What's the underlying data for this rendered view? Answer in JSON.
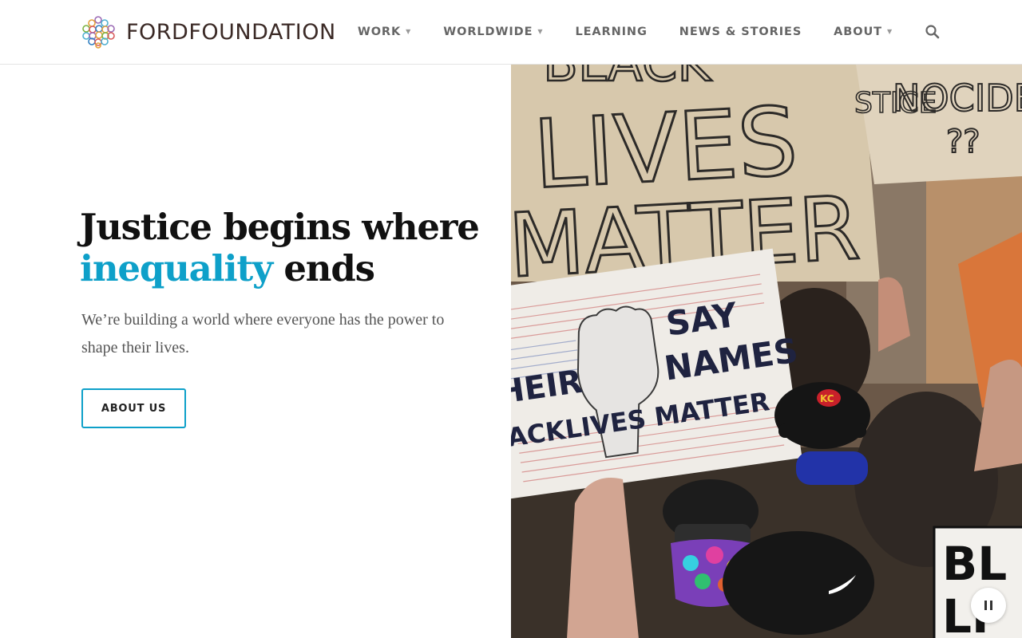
{
  "brand": {
    "name_strong": "FORD",
    "name_light": "FOUNDATION",
    "icon": "ford-foundation-logo-mark"
  },
  "nav": {
    "items": [
      {
        "label": "WORK",
        "has_dropdown": true
      },
      {
        "label": "WORLDWIDE",
        "has_dropdown": true
      },
      {
        "label": "LEARNING",
        "has_dropdown": false
      },
      {
        "label": "NEWS & STORIES",
        "has_dropdown": false
      },
      {
        "label": "ABOUT",
        "has_dropdown": true
      }
    ],
    "search_icon": "search-icon"
  },
  "hero": {
    "headline_part1": "Justice begins where",
    "headline_accent": "inequality",
    "headline_part2": "ends",
    "subtext": "We’re building a world where everyone has the power to shape their lives.",
    "cta_label": "ABOUT US",
    "media": {
      "sign_top_line1": "LIVES",
      "sign_top_line2": "MATTER",
      "sign_top_partial": "BLACK",
      "sign_corner": "NOCIDE",
      "sign_corner2": "STICE",
      "sign_corner3": "??",
      "sign_mid_say": "SAY",
      "sign_mid_names": "NAMES",
      "sign_mid_their": "HEIR",
      "sign_mid_bottom": "ACKLIVES MATTER",
      "cap_logo": "KC",
      "sign_bottom_right": "BL",
      "sign_bottom_right2": "LI"
    },
    "pause_icon": "pause-icon"
  },
  "colors": {
    "accent": "#0ea0c9",
    "nav_text": "#666666",
    "headline": "#111111",
    "brand_text": "#3b2a26"
  }
}
